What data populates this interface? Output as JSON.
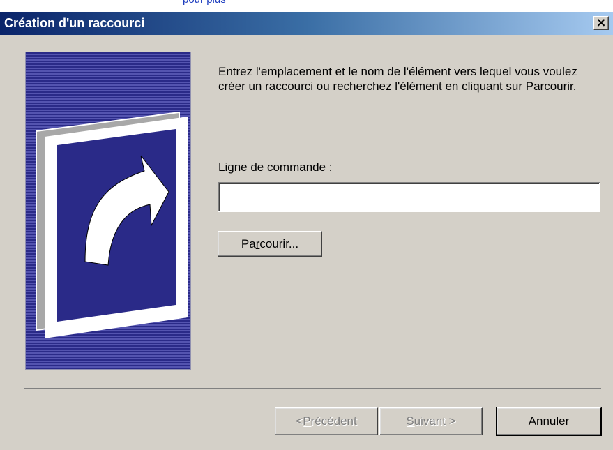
{
  "background_fragment": "pour plus",
  "window": {
    "title": "Création d'un raccourci",
    "close_glyph": "×"
  },
  "banner": {
    "icon": "shortcut-arrow-icon"
  },
  "content": {
    "intro": "Entrez l'emplacement et le nom de l'élément vers lequel vous voulez créer un raccourci ou recherchez l'élément en cliquant sur Parcourir.",
    "cmd_label_accel": "L",
    "cmd_label_rest": "igne de commande :",
    "cmd_value": "",
    "browse_pre": "Pa",
    "browse_accel": "r",
    "browse_post": "courir..."
  },
  "footer": {
    "prev_pre": "< ",
    "prev_accel": "P",
    "prev_post": "récédent",
    "next_accel": "S",
    "next_post": "uivant >",
    "cancel_label": "Annuler"
  },
  "colors": {
    "title_bar_start": "#0a246a",
    "title_bar_end": "#a6caf0",
    "dialog_face": "#d4d0c8",
    "banner_blue": "#2a2a88"
  }
}
